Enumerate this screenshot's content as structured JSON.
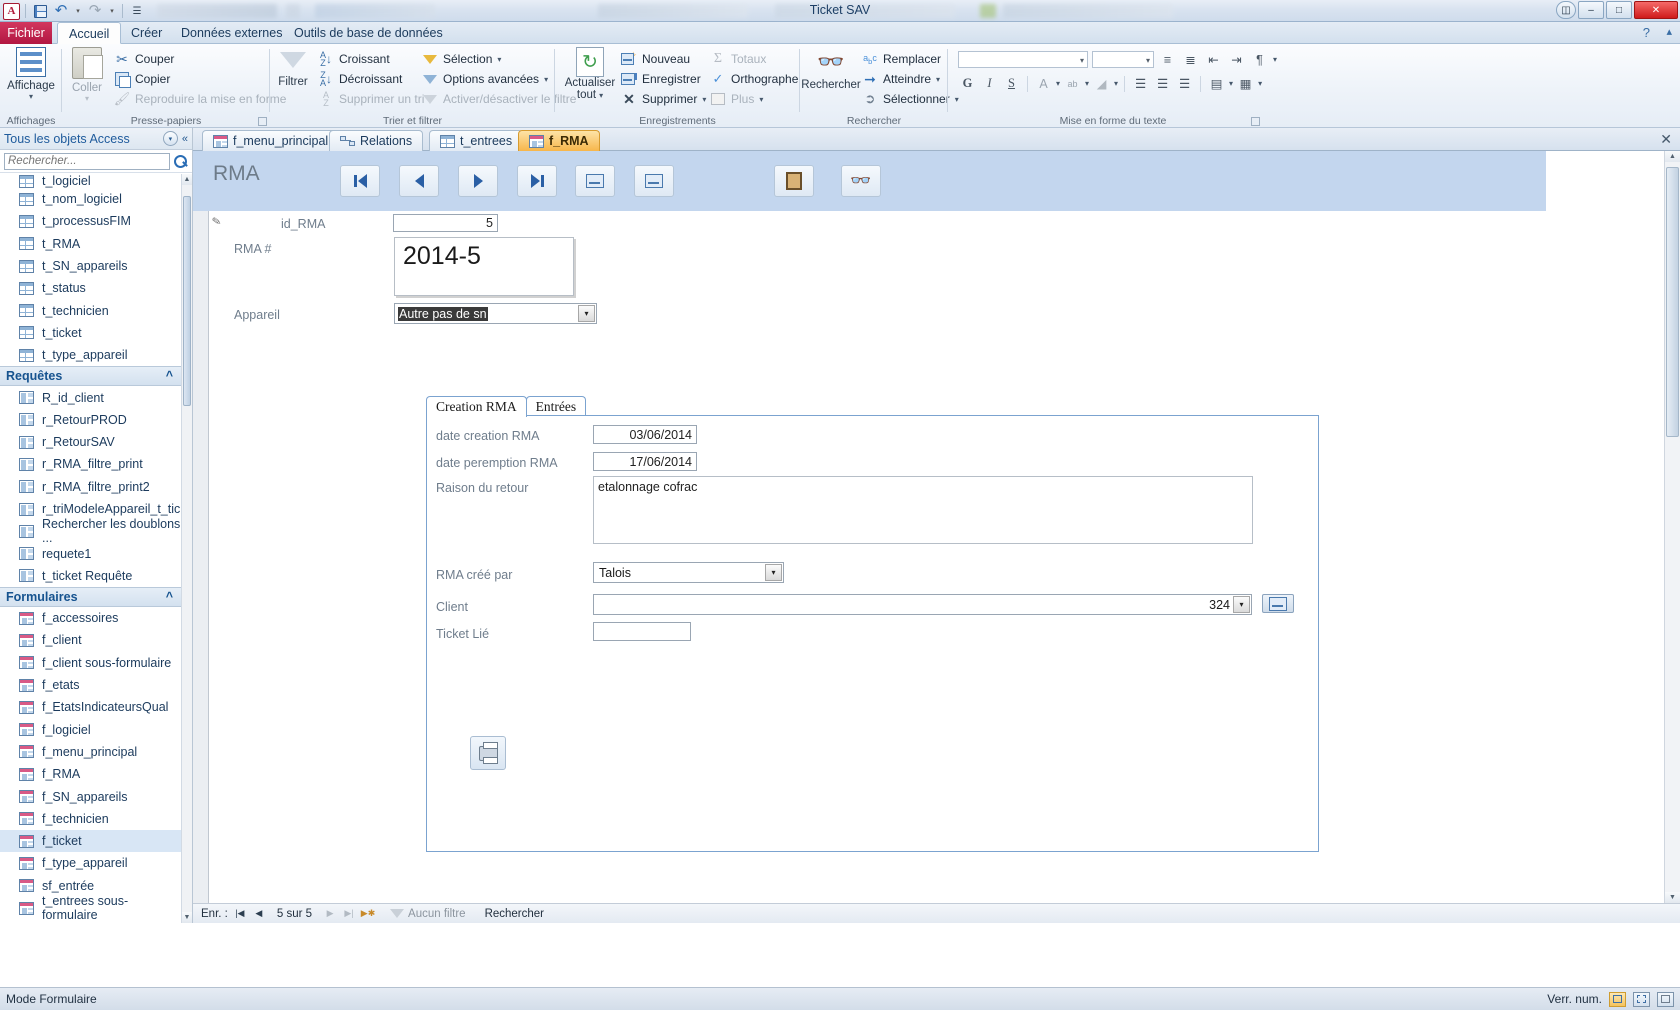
{
  "window": {
    "title": "Ticket SAV",
    "minimize": "–",
    "maximize": "□",
    "close": "✕",
    "help": "?",
    "ribbon_collapse": "▴"
  },
  "quick_access": {
    "app_icon": "A",
    "save": "save-icon",
    "undo": "↶",
    "redo": "↷",
    "customize": "▾"
  },
  "ribbon_tabs": [
    {
      "label": "Fichier",
      "active": false,
      "file": true
    },
    {
      "label": "Accueil",
      "active": true
    },
    {
      "label": "Créer",
      "active": false
    },
    {
      "label": "Données externes",
      "active": false
    },
    {
      "label": "Outils de base de données",
      "active": false
    }
  ],
  "ribbon": {
    "groups": [
      {
        "name": "Affichages",
        "label": "Affichages"
      },
      {
        "name": "Presse-papiers",
        "label": "Presse-papiers"
      },
      {
        "name": "Trier et filtrer",
        "label": "Trier et filtrer"
      },
      {
        "name": "Enregistrements",
        "label": "Enregistrements"
      },
      {
        "name": "Rechercher",
        "label": "Rechercher"
      },
      {
        "name": "Mise en forme du texte",
        "label": "Mise en forme du texte"
      }
    ],
    "affichage": {
      "label": "Affichage",
      "dropdown": "▾"
    },
    "coller": {
      "label": "Coller",
      "dropdown": "▾"
    },
    "couper": {
      "label": "Couper"
    },
    "copier": {
      "label": "Copier"
    },
    "reproduire": {
      "label": "Reproduire la mise en forme"
    },
    "filtrer": {
      "label": "Filtrer"
    },
    "croissant": {
      "label": "Croissant"
    },
    "decroissant": {
      "label": "Décroissant"
    },
    "supprimer_tri": {
      "label": "Supprimer un tri"
    },
    "selection": {
      "label": "Sélection",
      "dropdown": "▾"
    },
    "options_avancees": {
      "label": "Options avancées",
      "dropdown": "▾"
    },
    "activer_filtre": {
      "label": "Activer/désactiver le filtre"
    },
    "actualiser": {
      "label": "Actualiser",
      "label2": "tout",
      "dropdown": "▾"
    },
    "nouveau": {
      "label": "Nouveau"
    },
    "enregistrer": {
      "label": "Enregistrer"
    },
    "supprimer": {
      "label": "Supprimer",
      "dropdown": "▾"
    },
    "totaux": {
      "label": "Totaux"
    },
    "orthographe": {
      "label": "Orthographe"
    },
    "plus": {
      "label": "Plus",
      "dropdown": "▾"
    },
    "rechercher": {
      "label": "Rechercher"
    },
    "remplacer": {
      "label": "Remplacer"
    },
    "atteindre": {
      "label": "Atteindre",
      "dropdown": "▾"
    },
    "selectionner": {
      "label": "Sélectionner",
      "dropdown": "▾"
    },
    "font_name": "",
    "font_size": "",
    "bold": "G",
    "italic": "I",
    "underline": "S",
    "font_color": "A",
    "highlight": "ab",
    "fill_color": "◢"
  },
  "nav_pane": {
    "header": "Tous les objets Access",
    "search_placeholder": "Rechercher...",
    "collapse_icon": "«",
    "dropdown_icon": "▾",
    "search_icon": "search-icon",
    "groups": [
      {
        "label": "",
        "type": "table",
        "items": [
          "t_logiciel",
          "t_nom_logiciel",
          "t_processusFIM",
          "t_RMA",
          "t_SN_appareils",
          "t_status",
          "t_technicien",
          "t_ticket",
          "t_type_appareil"
        ]
      },
      {
        "label": "Requêtes",
        "type": "query",
        "items": [
          "R_id_client",
          "r_RetourPROD",
          "r_RetourSAV",
          "r_RMA_filtre_print",
          "r_RMA_filtre_print2",
          "r_triModeleAppareil_t_tic...",
          "Rechercher les doublons ...",
          "requete1",
          "t_ticket Requête"
        ]
      },
      {
        "label": "Formulaires",
        "type": "form",
        "items": [
          "f_accessoires",
          "f_client",
          "f_client sous-formulaire",
          "f_etats",
          "f_EtatsIndicateursQual",
          "f_logiciel",
          "f_menu_principal",
          "f_RMA",
          "f_SN_appareils",
          "f_technicien",
          "f_ticket",
          "f_type_appareil",
          "sf_entrée",
          "t_entrees sous-formulaire"
        ]
      }
    ],
    "selected_item": "f_ticket"
  },
  "doc_tabs": [
    {
      "label": "f_menu_principal",
      "icon": "form-icon",
      "active": false
    },
    {
      "label": "Relations",
      "icon": "relations-icon",
      "active": false
    },
    {
      "label": "t_entrees",
      "icon": "table-icon",
      "active": false
    },
    {
      "label": "f_RMA",
      "icon": "form-icon",
      "active": true
    }
  ],
  "doc_close": "✕",
  "form": {
    "title": "RMA",
    "header_buttons": [
      {
        "name": "first-record-button",
        "glyph": "|◀"
      },
      {
        "name": "previous-record-button",
        "glyph": "◀"
      },
      {
        "name": "next-record-button",
        "glyph": "▶"
      },
      {
        "name": "last-record-button",
        "glyph": "▶|"
      },
      {
        "name": "new-record-button",
        "glyph": "new-record-icon"
      },
      {
        "name": "save-record-button",
        "glyph": "save-record-icon"
      },
      {
        "name": "close-form-button",
        "glyph": "exit-door-icon"
      },
      {
        "name": "find-button",
        "glyph": "binoculars-icon"
      }
    ],
    "fields": {
      "id_rma": {
        "label": "id_RMA",
        "value": "5"
      },
      "rma_number": {
        "label": "RMA #",
        "value": "2014-5"
      },
      "appareil": {
        "label": "Appareil",
        "value": "Autre pas de sn",
        "dropdown": "▾"
      }
    },
    "tabs": [
      {
        "label": "Creation RMA",
        "active": true
      },
      {
        "label": "Entrées",
        "active": false
      }
    ],
    "tab_fields": {
      "date_creation": {
        "label": "date creation RMA",
        "value": "03/06/2014"
      },
      "date_peremption": {
        "label": "date peremption RMA",
        "value": "17/06/2014"
      },
      "raison_retour": {
        "label": "Raison du retour",
        "value": "etalonnage cofrac"
      },
      "rma_cree_par": {
        "label": "RMA créé par",
        "value": "Talois",
        "dropdown": "▾"
      },
      "client": {
        "label": "Client",
        "value": "324",
        "dropdown": "▾"
      },
      "ticket_lie": {
        "label": "Ticket Lié",
        "value": ""
      }
    },
    "print_button": "print-icon",
    "client_button": "open-client-icon"
  },
  "record_nav": {
    "label": "Enr. :",
    "first": "|◀",
    "prev": "◀",
    "position": "5 sur 5",
    "next": "▶",
    "last": "▶|",
    "new": "▶✱",
    "filter_text": "Aucun filtre",
    "search_text": "Rechercher",
    "filter_icon": "filter-icon"
  },
  "status_bar": {
    "mode": "Mode Formulaire",
    "numlock": "Verr. num.",
    "view_form_icon": "form-view-icon",
    "view_layout_icon": "layout-view-icon",
    "view_design_icon": "design-view-icon"
  },
  "colors": {
    "accent": "#1f5b9c",
    "file_tab": "#b21742",
    "active_doc_tab": "#f7b64b",
    "form_header": "#c3d6ee",
    "selection": "#3a3a3a"
  }
}
